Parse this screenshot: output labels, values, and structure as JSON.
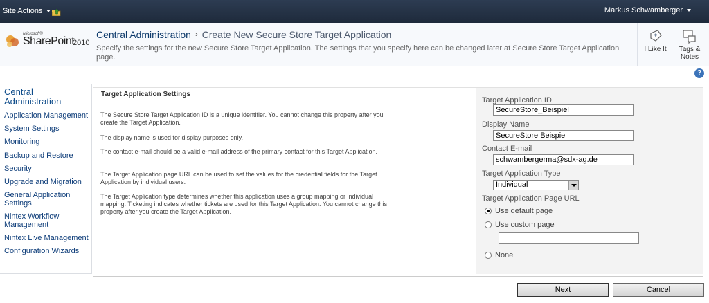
{
  "topbar": {
    "site_actions": "Site Actions",
    "user": "Markus Schwamberger"
  },
  "logo": {
    "microsoft": "Microsoft®",
    "product": "SharePoint",
    "version": "2010"
  },
  "breadcrumb": {
    "root": "Central Administration",
    "separator": "›",
    "current": "Create New Secure Store Target Application"
  },
  "description": "Specify the settings for the new Secure Store Target Application. The settings that you specify here can be changed later at Secure Store Target Application page.",
  "social": {
    "like": "I Like It",
    "tags": "Tags &",
    "notes": "Notes"
  },
  "help": "?",
  "leftnav": {
    "heading": "Central Administration",
    "items": [
      "Application Management",
      "System Settings",
      "Monitoring",
      "Backup and Restore",
      "Security",
      "Upgrade and Migration",
      "General Application Settings",
      "Nintex Workflow Management",
      "Nintex Live Management",
      "Configuration Wizards"
    ]
  },
  "section": {
    "title": "Target Application Settings",
    "paragraphs": [
      "The Secure Store Target Application ID is a unique identifier. You cannot change this property after you create the Target Application.",
      "The display name is used for display purposes only.",
      "The contact e-mail should be a valid e-mail address of the primary contact for this Target Application.",
      "The Target Application page URL can be used to set the values for the credential fields for the Target Application by individual users.",
      "The Target Application type determines whether this application uses a group mapping or individual mapping. Ticketing indicates whether tickets are used for this Target Application. You cannot change this property after you create the Target Application."
    ]
  },
  "form": {
    "id_label": "Target Application ID",
    "id_value": "SecureStore_Beispiel",
    "name_label": "Display Name",
    "name_value": "SecureStore Beispiel",
    "email_label": "Contact E-mail",
    "email_value": "schwambergerma@sdx-ag.de",
    "type_label": "Target Application Type",
    "type_value": "Individual",
    "url_label": "Target Application Page URL",
    "url_options": [
      "Use default page",
      "Use custom page",
      "None"
    ],
    "custom_url_value": ""
  },
  "buttons": {
    "next": "Next",
    "cancel": "Cancel"
  }
}
